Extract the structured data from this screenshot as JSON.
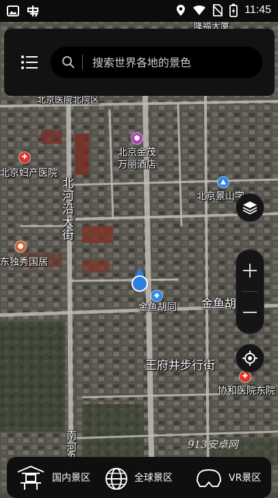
{
  "status_bar": {
    "time": "11:45",
    "left_icons": [
      "image-icon",
      "app-notification-icon"
    ],
    "right_icons": [
      "location-icon",
      "wifi-icon",
      "no-sim-icon",
      "battery-charging-icon"
    ]
  },
  "search": {
    "placeholder": "搜索世界各地的景色"
  },
  "map_labels": {
    "top": "隆福大厦",
    "hospital_top": "北京医院北院区",
    "hotel_1": "北京金茂",
    "hotel_2": "万丽酒店",
    "maternity": "北京妇产医院",
    "jingshan": "北京景山学",
    "road_north": "北河沿大街",
    "dongxiu": "东独秀国居",
    "jinyu_poi": "金鱼胡同",
    "jinyu_road": "金鱼胡",
    "wangfujing": "王府井步行街",
    "xiehe": "协和医院东院",
    "road_south": "南河沿"
  },
  "watermark": "913安卓网",
  "bottom_nav": {
    "items": [
      {
        "label": "国内景区",
        "icon": "pavilion-icon"
      },
      {
        "label": "全球景区",
        "icon": "globe-icon"
      },
      {
        "label": "VR景区",
        "icon": "vr-headset-icon"
      }
    ]
  },
  "colors": {
    "panel_bg": "#121212",
    "location_dot": "#2e7fe0",
    "poi_red": "#e0342a",
    "poi_purple": "#b03cb8",
    "poi_blue": "#2d8ae8"
  }
}
